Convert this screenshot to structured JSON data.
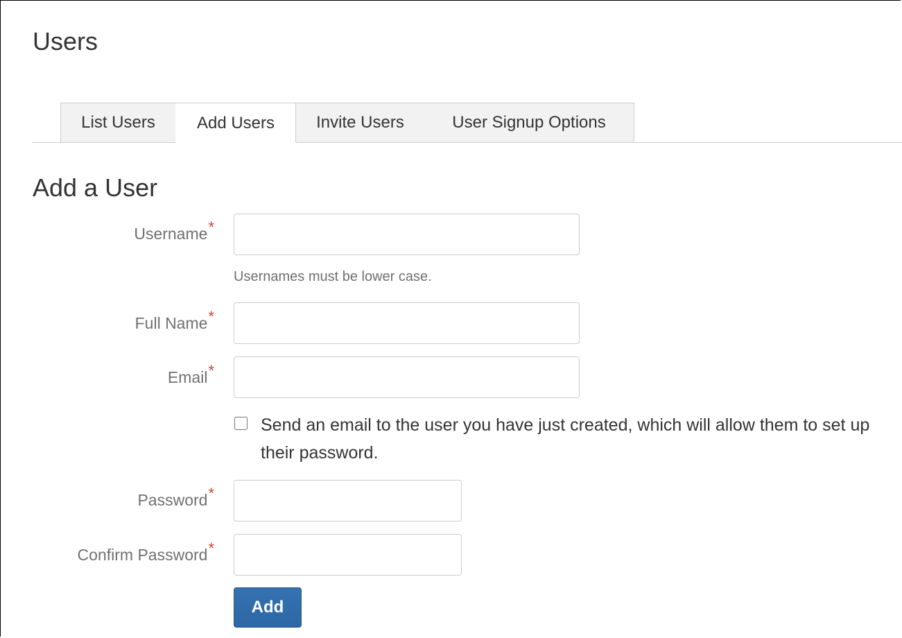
{
  "page": {
    "title": "Users"
  },
  "tabs": [
    {
      "label": "List Users",
      "active": false
    },
    {
      "label": "Add Users",
      "active": true
    },
    {
      "label": "Invite Users",
      "active": false
    },
    {
      "label": "User Signup Options",
      "active": false
    }
  ],
  "form": {
    "title": "Add a User",
    "required_marker": "*",
    "username": {
      "label": "Username",
      "value": "",
      "hint": "Usernames must be lower case."
    },
    "full_name": {
      "label": "Full Name",
      "value": ""
    },
    "email": {
      "label": "Email",
      "value": ""
    },
    "send_email": {
      "checked": false,
      "label": "Send an email to the user you have just created, which will allow them to set up their password."
    },
    "password": {
      "label": "Password",
      "value": ""
    },
    "confirm_password": {
      "label": "Confirm Password",
      "value": ""
    },
    "submit_label": "Add"
  },
  "colors": {
    "primary_button": "#3572b0",
    "required": "#d04437",
    "label_text": "#707070",
    "tab_background": "#f2f2f2",
    "border": "#cccccc"
  }
}
